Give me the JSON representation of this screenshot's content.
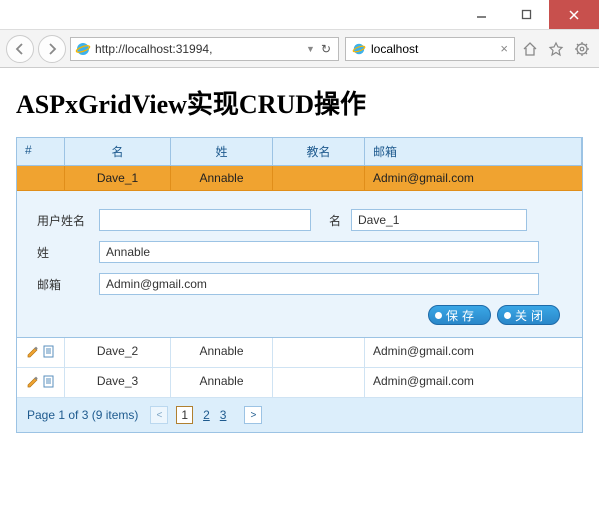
{
  "window": {
    "minimize": "–",
    "maximize": "▢",
    "close": "✕"
  },
  "browser": {
    "url": "http://localhost:31994,",
    "refresh_icon": "↻",
    "tab_title": "localhost",
    "tab_close": "×"
  },
  "page": {
    "heading": "ASPxGridView实现CRUD操作"
  },
  "grid": {
    "headers": {
      "cmd": "#",
      "name": "名",
      "surname": "姓",
      "nick": "教名",
      "email": "邮箱"
    },
    "selected_row": {
      "name": "Dave_1",
      "surname": "Annable",
      "nick": "",
      "email": "Admin@gmail.com"
    },
    "rows": [
      {
        "name": "Dave_2",
        "surname": "Annable",
        "nick": "",
        "email": "Admin@gmail.com"
      },
      {
        "name": "Dave_3",
        "surname": "Annable",
        "nick": "",
        "email": "Admin@gmail.com"
      }
    ]
  },
  "form": {
    "labels": {
      "username": "用户姓名",
      "name": "名",
      "surname": "姓",
      "email": "邮箱"
    },
    "values": {
      "username": "",
      "name": "Dave_1",
      "surname": "Annable",
      "email": "Admin@gmail.com"
    },
    "buttons": {
      "save": "保存",
      "close": "关闭"
    }
  },
  "pager": {
    "text": "Page 1 of 3 (9 items)",
    "prev": "<",
    "pages": [
      "1",
      "2",
      "3"
    ],
    "current": 1,
    "next": ">"
  }
}
